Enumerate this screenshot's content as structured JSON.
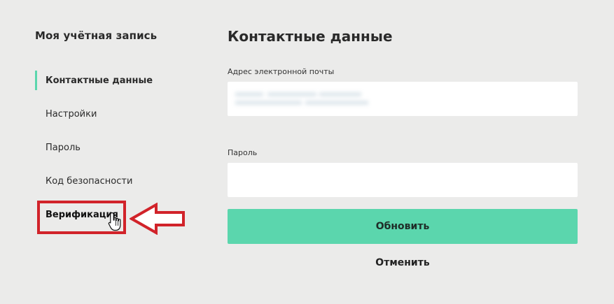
{
  "sidebar": {
    "title": "Моя учётная запись",
    "items": [
      {
        "label": "Контактные данные",
        "active": true
      },
      {
        "label": "Настройки",
        "active": false
      },
      {
        "label": "Пароль",
        "active": false
      },
      {
        "label": "Код безопасности",
        "active": false
      },
      {
        "label": "Верификация",
        "active": false,
        "highlighted": true
      }
    ]
  },
  "main": {
    "title": "Контактные данные",
    "email_field": {
      "label": "Адрес электронной почты",
      "value": ""
    },
    "password_field": {
      "label": "Пароль",
      "value": ""
    },
    "update_button": "Обновить",
    "cancel_link": "Отменить"
  },
  "colors": {
    "accent": "#5bd6ad",
    "annotation": "#d1232a",
    "background": "#ebebea"
  },
  "icons": {
    "annotation_arrow": "left-arrow-icon",
    "cursor": "hand-pointer-icon"
  }
}
